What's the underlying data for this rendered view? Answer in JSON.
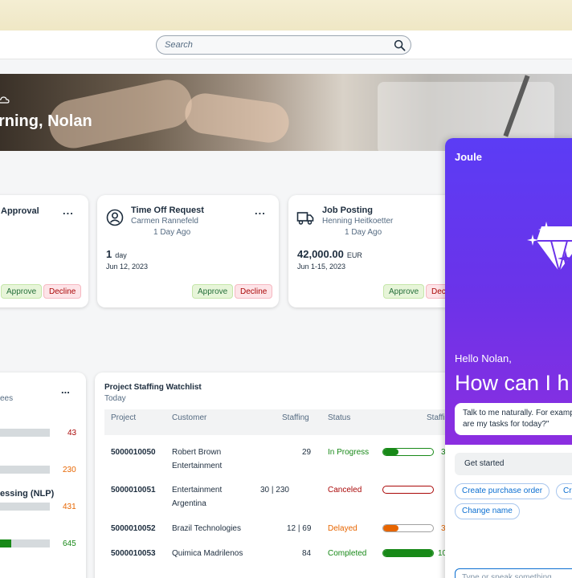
{
  "search": {
    "placeholder": "Search"
  },
  "hero": {
    "greeting": "rning, Nolan"
  },
  "cards": [
    {
      "title": "Approval",
      "more": "...",
      "approve": "Approve",
      "decline": "Decline"
    },
    {
      "title": "Time Off Request",
      "person": "Carmen Rannefeld",
      "ago": "1 Day Ago",
      "value": "1",
      "unit": "day",
      "date": "Jun 12, 2023",
      "more": "...",
      "approve": "Approve",
      "decline": "Decline",
      "icon": "user-icon"
    },
    {
      "title": "Job Posting",
      "person": "Henning Heitkoetter",
      "ago": "1 Day Ago",
      "value": "42,000.00",
      "unit": "EUR",
      "date": "Jun 1-15, 2023",
      "more": "...",
      "approve": "Approve",
      "decline": "Decl",
      "icon": "truck-icon"
    }
  ],
  "skills": {
    "subtitle": "ees",
    "more": "...",
    "rows": [
      {
        "label": "",
        "value": "43",
        "color": "#aa0808",
        "fill": 0
      },
      {
        "label": "",
        "value": "230",
        "color": "#e76500",
        "fill": 0
      },
      {
        "label": "essing (NLP)",
        "value": "431",
        "color": "#e76500",
        "fill": 0
      },
      {
        "label": "",
        "value": "645",
        "color": "#188918",
        "fill": 0.25
      }
    ]
  },
  "watchlist": {
    "title": "Project Staffing Watchlist",
    "subtitle": "Today",
    "headers": {
      "project": "Project",
      "customer": "Customer",
      "staffing": "Staffing",
      "status": "Status",
      "staffing2": "Staffi"
    },
    "rows": [
      {
        "project": "5000010050",
        "customer1": "Robert Brown",
        "customer2": "Entertainment",
        "staffing": "29",
        "status": "In Progress",
        "status_color": "#188918",
        "fill": 0.3,
        "fill_color": "#188918",
        "border_color": "#188918",
        "pct": "3"
      },
      {
        "project": "5000010051",
        "customer1": "Entertainment",
        "customer2": "Argentina",
        "staffing": "30 | 230",
        "status": "Canceled",
        "status_color": "#aa0808",
        "fill": 0,
        "fill_color": "#aa0808",
        "border_color": "#aa0808",
        "pct": ""
      },
      {
        "project": "5000010052",
        "customer1": "Brazil Technologies",
        "customer2": "",
        "staffing": "12 | 69",
        "status": "Delayed",
        "status_color": "#e76500",
        "fill": 0.3,
        "fill_color": "#e76500",
        "border_color": "#e76500",
        "pct": "3"
      },
      {
        "project": "5000010053",
        "customer1": "Quimica Madrilenos",
        "customer2": "",
        "staffing": "84",
        "status": "Completed",
        "status_color": "#188918",
        "fill": 1,
        "fill_color": "#188918",
        "border_color": "#188918",
        "pct": "10"
      }
    ]
  },
  "joule": {
    "title": "Joule",
    "hello": "Hello Nolan,",
    "how": "How can I h",
    "bubble_line1": "Talk to me naturally. For examp",
    "bubble_line2": "are my tasks for today?\"",
    "get_started": "Get started",
    "chips": [
      "Create purchase order",
      "Cr",
      "Change name"
    ],
    "input_placeholder": "Type or speak something"
  },
  "colors": {
    "joule_purple": "#5b3cf5",
    "accent_blue": "#0a6ed1"
  }
}
